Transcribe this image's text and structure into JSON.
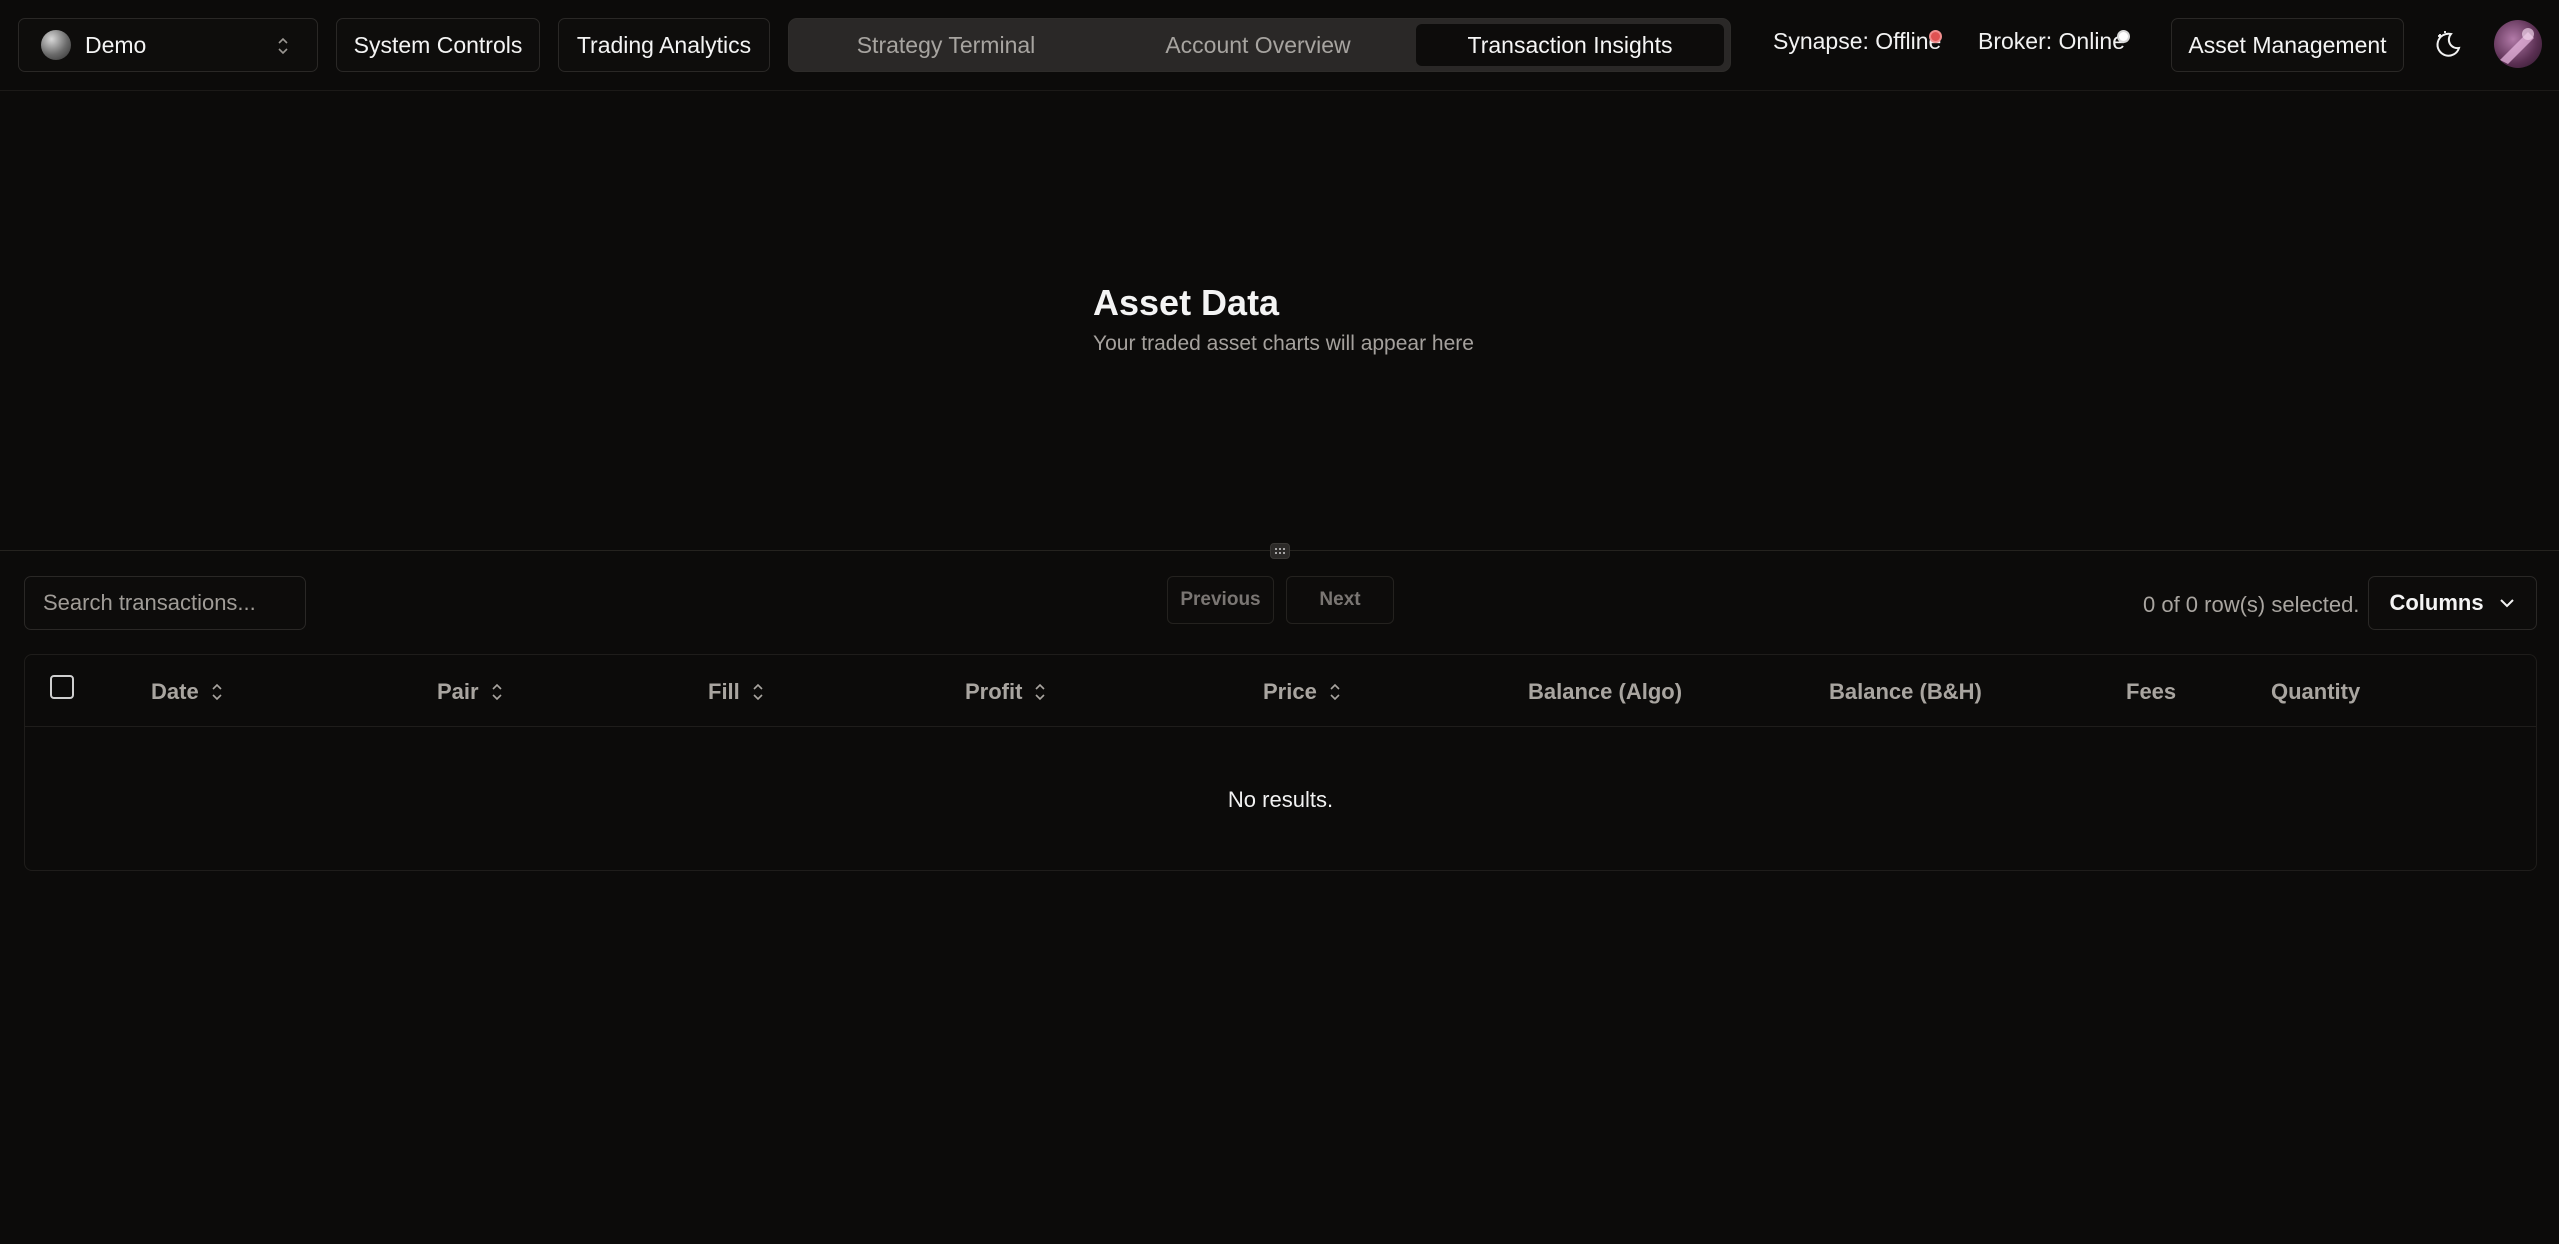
{
  "topbar": {
    "workspace": {
      "label": "Demo",
      "icon": "orb-icon"
    },
    "system_controls": "System Controls",
    "trading_analytics": "Trading Analytics",
    "tabs": [
      {
        "label": "Strategy Terminal",
        "active": false
      },
      {
        "label": "Account Overview",
        "active": false
      },
      {
        "label": "Transaction Insights",
        "active": true
      }
    ],
    "synapse_status": "Synapse: Offline",
    "synapse_color": "#e05252",
    "broker_status": "Broker: Online",
    "broker_color": "#ffffff",
    "asset_management": "Asset Management",
    "theme_icon": "moon-icon",
    "avatar": "avatar"
  },
  "hero": {
    "title": "Asset Data",
    "subtitle": "Your traded asset charts will appear here"
  },
  "toolbar": {
    "search_placeholder": "Search transactions...",
    "previous": "Previous",
    "next": "Next",
    "selected": "0 of 0 row(s) selected.",
    "columns": "Columns"
  },
  "table": {
    "columns": [
      {
        "label": "Date",
        "sortable": true
      },
      {
        "label": "Pair",
        "sortable": true
      },
      {
        "label": "Fill",
        "sortable": true
      },
      {
        "label": "Profit",
        "sortable": true
      },
      {
        "label": "Price",
        "sortable": true
      },
      {
        "label": "Balance (Algo)",
        "sortable": false
      },
      {
        "label": "Balance (B&H)",
        "sortable": false
      },
      {
        "label": "Fees",
        "sortable": false
      },
      {
        "label": "Quantity",
        "sortable": false
      }
    ],
    "empty": "No results."
  }
}
